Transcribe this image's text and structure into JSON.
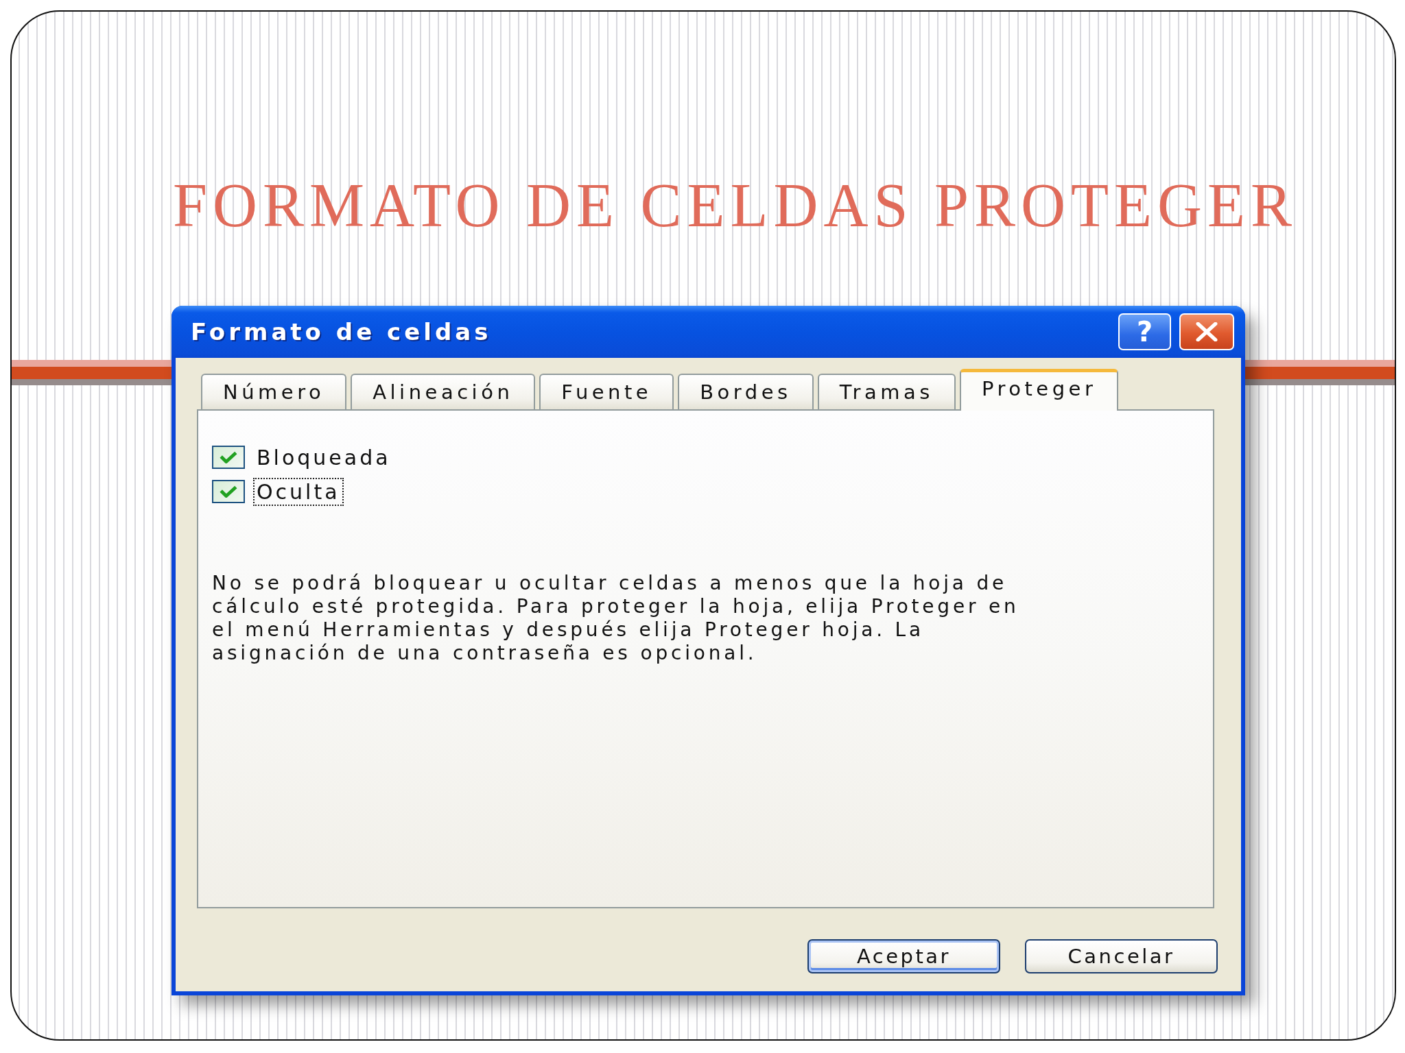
{
  "slide": {
    "title": "FORMATO DE CELDAS PROTEGER"
  },
  "dialog": {
    "title": "Formato de celdas",
    "title_buttons": [
      {
        "kind": "help",
        "label": "?"
      },
      {
        "kind": "close"
      }
    ],
    "tabs": [
      {
        "label": "Número",
        "selected": false
      },
      {
        "label": "Alineación",
        "selected": false
      },
      {
        "label": "Fuente",
        "selected": false
      },
      {
        "label": "Bordes",
        "selected": false
      },
      {
        "label": "Tramas",
        "selected": false
      },
      {
        "label": "Proteger",
        "selected": true
      }
    ],
    "checkboxes": [
      {
        "label": "Bloqueada",
        "checked": true,
        "focused": false
      },
      {
        "label": "Oculta",
        "checked": true,
        "focused": true
      }
    ],
    "note": "No se podrá bloquear u ocultar celdas a menos que la hoja de cálculo esté protegida. Para proteger la hoja, elija Proteger en el menú Herramientas y después elija Proteger hoja. La asignación de una contraseña es opcional.",
    "buttons": [
      {
        "label": "Aceptar",
        "default": true
      },
      {
        "label": "Cancelar",
        "default": false
      }
    ]
  }
}
